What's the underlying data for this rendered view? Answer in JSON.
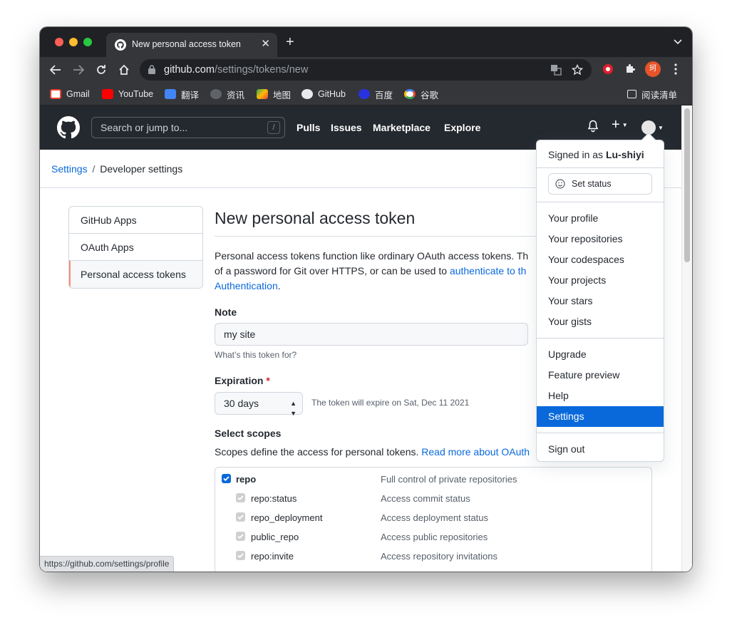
{
  "browser": {
    "tab_title": "New personal access token",
    "tab_close": "✕",
    "new_tab": "+",
    "url_host": "github.com",
    "url_path": "/settings/tokens/new",
    "profile_initial": "珂",
    "bookmarks": [
      "Gmail",
      "YouTube",
      "翻译",
      "资讯",
      "地图",
      "GitHub",
      "百度",
      "谷歌"
    ],
    "reading_list": "阅读清单",
    "status_url": "https://github.com/settings/profile"
  },
  "header": {
    "search_placeholder": "Search or jump to...",
    "search_shortcut": "/",
    "nav": [
      "Pulls",
      "Issues",
      "Marketplace",
      "Explore"
    ],
    "plus": "+"
  },
  "breadcrumb": {
    "root": "Settings",
    "separator": "/",
    "current": "Developer settings"
  },
  "sidebar": {
    "items": [
      "GitHub Apps",
      "OAuth Apps",
      "Personal access tokens"
    ]
  },
  "main": {
    "title": "New personal access token",
    "desc_line1": "Personal access tokens function like ordinary OAuth access tokens. Th",
    "desc_line2_a": "of a password for Git over HTTPS, or can be used to ",
    "desc_line2_link": "authenticate to th",
    "desc_line3_link": "Authentication",
    "desc_line3_end": ".",
    "note_label": "Note",
    "note_value": "my site",
    "note_hint": "What’s this token for?",
    "expiration_label": "Expiration",
    "required_mark": "*",
    "expiration_value": "30 days",
    "expiration_note": "The token will expire on Sat, Dec 11 2021",
    "scopes_label": "Select scopes",
    "scopes_desc": "Scopes define the access for personal tokens. ",
    "scopes_link": "Read more about OAuth",
    "scopes": [
      {
        "name": "repo",
        "desc": "Full control of private repositories"
      },
      {
        "name": "repo:status",
        "desc": "Access commit status"
      },
      {
        "name": "repo_deployment",
        "desc": "Access deployment status"
      },
      {
        "name": "public_repo",
        "desc": "Access public repositories"
      },
      {
        "name": "repo:invite",
        "desc": "Access repository invitations"
      }
    ]
  },
  "dropdown": {
    "signed_in_prefix": "Signed in as ",
    "username": "Lu-shiyi",
    "set_status": "Set status",
    "group1": [
      "Your profile",
      "Your repositories",
      "Your codespaces",
      "Your projects",
      "Your stars",
      "Your gists"
    ],
    "group2": [
      "Upgrade",
      "Feature preview",
      "Help",
      "Settings"
    ],
    "sign_out": "Sign out"
  },
  "colors": {
    "accent": "#0969da",
    "header_bg": "#24292f",
    "selected_border": "#fd8c73"
  }
}
